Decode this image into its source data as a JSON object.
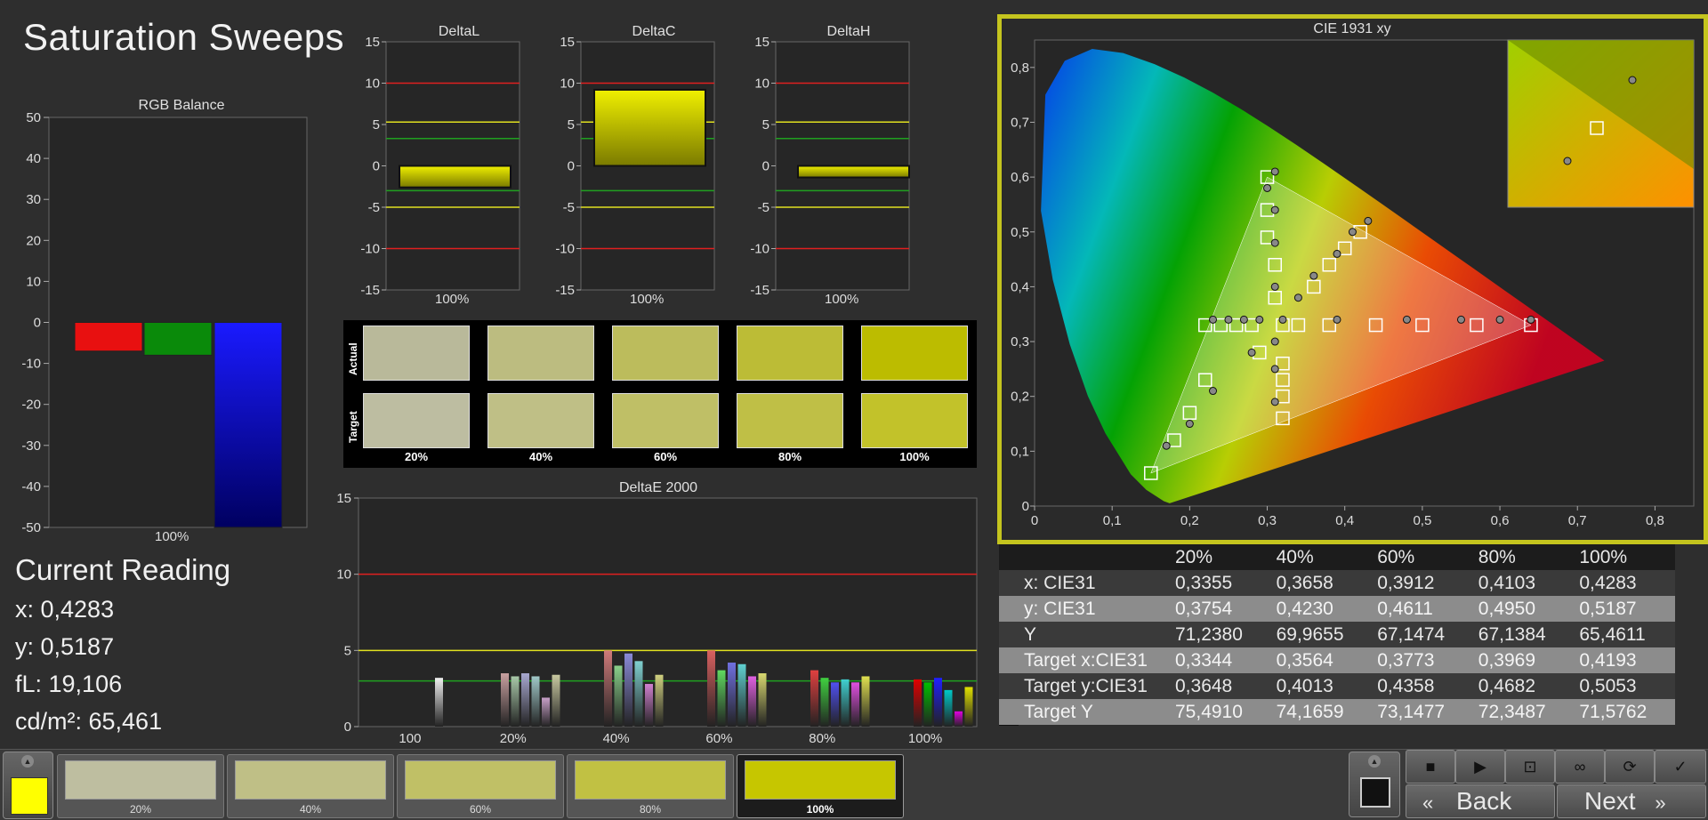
{
  "title": "Saturation Sweeps",
  "rgb_balance": {
    "title": "RGB Balance",
    "y_ticks": [
      "50",
      "40",
      "30",
      "20",
      "10",
      "0",
      "-10",
      "-20",
      "-30",
      "-40",
      "-50"
    ],
    "x_label": "100%",
    "bars": [
      {
        "name": "red",
        "value": -7,
        "color": "#e81010"
      },
      {
        "name": "green",
        "value": -8,
        "color": "#0a8a0a"
      },
      {
        "name": "blue",
        "value": -50,
        "color": "#1a1aff"
      }
    ]
  },
  "delta_charts": [
    {
      "title": "DeltaL",
      "value": -2.6,
      "x_label": "100%"
    },
    {
      "title": "DeltaC",
      "value": 9.2,
      "x_label": "100%"
    },
    {
      "title": "DeltaH",
      "value": -1.4,
      "x_label": "100%"
    }
  ],
  "delta_ticks": [
    "15",
    "10",
    "5",
    "0",
    "-5",
    "-10",
    "-15"
  ],
  "swatches": {
    "actual_label": "Actual",
    "target_label": "Target",
    "columns": [
      {
        "label": "20%",
        "actual": "#b9b99a",
        "target": "#bdbda1"
      },
      {
        "label": "40%",
        "actual": "#bcbc80",
        "target": "#bfbf86"
      },
      {
        "label": "60%",
        "actual": "#bcbc5c",
        "target": "#bfbf66"
      },
      {
        "label": "80%",
        "actual": "#bcbc36",
        "target": "#bfbf46"
      },
      {
        "label": "100%",
        "actual": "#bcbc00",
        "target": "#c2c22a"
      }
    ]
  },
  "deltae": {
    "title": "DeltaE 2000",
    "y_ticks": [
      "15",
      "10",
      "5",
      "0"
    ],
    "groups": [
      "100",
      "20%",
      "40%",
      "60%",
      "80%",
      "100%"
    ]
  },
  "cie": {
    "title": "CIE 1931 xy",
    "x_ticks": [
      "0",
      "0,1",
      "0,2",
      "0,3",
      "0,4",
      "0,5",
      "0,6",
      "0,7",
      "0,8"
    ],
    "y_ticks": [
      "0,8",
      "0,7",
      "0,6",
      "0,5",
      "0,4",
      "0,3",
      "0,2",
      "0,1",
      "0"
    ]
  },
  "current_reading": {
    "title": "Current Reading",
    "x": "x: 0,4283",
    "y": "y: 0,5187",
    "fl": "fL: 19,106",
    "cdm2": "cd/m²: 65,461"
  },
  "table": {
    "headers": [
      "",
      "20%",
      "40%",
      "60%",
      "80%",
      "100%"
    ],
    "rows": [
      [
        "x: CIE31",
        "0,3355",
        "0,3658",
        "0,3912",
        "0,4103",
        "0,4283"
      ],
      [
        "y: CIE31",
        "0,3754",
        "0,4230",
        "0,4611",
        "0,4950",
        "0,5187"
      ],
      [
        "Y",
        "71,2380",
        "69,9655",
        "67,1474",
        "67,1384",
        "65,4611"
      ],
      [
        "Target x:CIE31",
        "0,3344",
        "0,3564",
        "0,3773",
        "0,3969",
        "0,4193"
      ],
      [
        "Target y:CIE31",
        "0,3648",
        "0,4013",
        "0,4358",
        "0,4682",
        "0,5053"
      ],
      [
        "Target Y",
        "75,4910",
        "74,1659",
        "73,1477",
        "72,3487",
        "71,5762"
      ]
    ]
  },
  "bottom": {
    "thumbs": [
      {
        "label": "20%",
        "color": "#bebea0"
      },
      {
        "label": "40%",
        "color": "#bfbf86"
      },
      {
        "label": "60%",
        "color": "#c0c066"
      },
      {
        "label": "80%",
        "color": "#c1c143"
      },
      {
        "label": "100%",
        "color": "#c6c600"
      }
    ],
    "back_label": "Back",
    "next_label": "Next"
  }
}
